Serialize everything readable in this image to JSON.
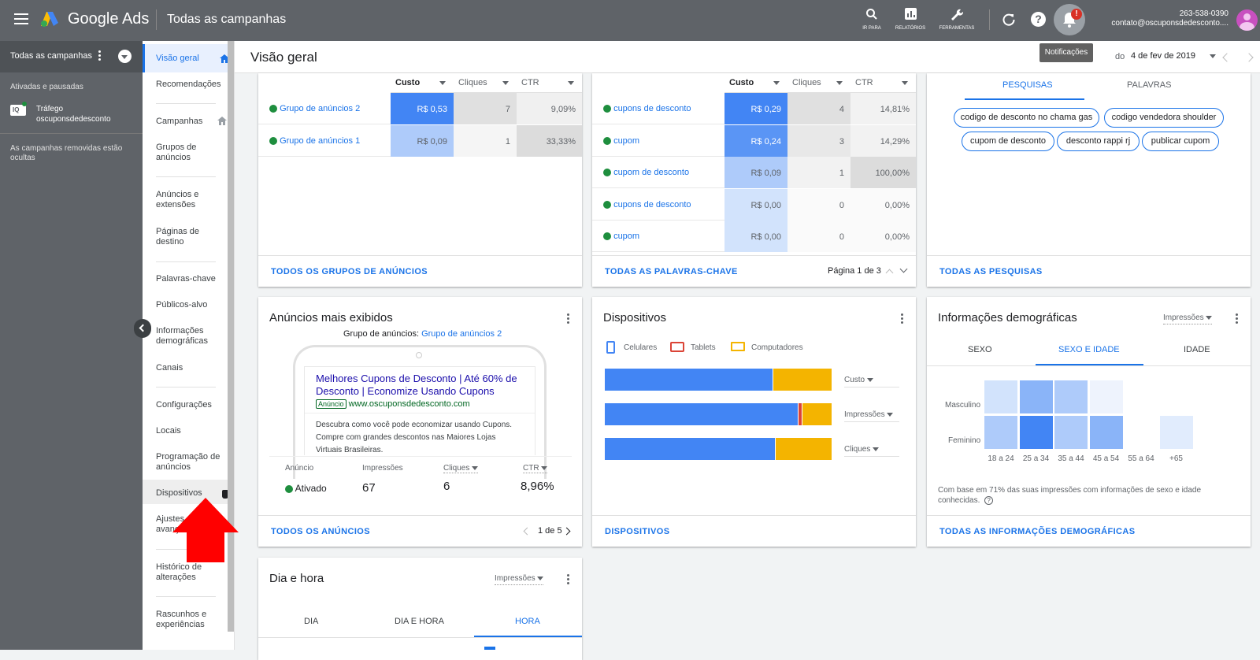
{
  "topbar": {
    "app_name": "Google Ads",
    "page_title": "Todas as campanhas",
    "tools": [
      {
        "label": "IR PARA",
        "icon": "search-icon"
      },
      {
        "label": "RELATÓRIOS",
        "icon": "reports-icon"
      },
      {
        "label": "FERRAMENTAS",
        "icon": "wrench-icon"
      }
    ],
    "customer_id": "263-538-0390",
    "account_email": "contato@oscuponsdedesconto....",
    "notification_tooltip": "Notificações",
    "notification_badge": "!"
  },
  "left_panel": {
    "campaign_selector": "Todas as campanhas",
    "section_label": "Ativadas e pausadas",
    "campaign_name": "Tráfego oscuponsdedesconto",
    "removed_note": "As campanhas removidas estão ocultas"
  },
  "nav": {
    "items": [
      "Visão geral",
      "Recomendações",
      "Campanhas",
      "Grupos de anúncios",
      "Anúncios e extensões",
      "Páginas de destino",
      "Palavras-chave",
      "Públicos-alvo",
      "Informações demográficas",
      "Canais",
      "Configurações",
      "Locais",
      "Programação de anúncios",
      "Dispositivos",
      "Ajustes avançados",
      "Histórico de alterações",
      "Rascunhos e experiências"
    ]
  },
  "header": {
    "title": "Visão geral",
    "date_prefix": "do",
    "date_range": "4 de fev de 2019"
  },
  "ad_groups_card": {
    "columns": [
      "Custo",
      "Cliques",
      "CTR"
    ],
    "rows": [
      {
        "name": "Grupo de anúncios 2",
        "cost": "R$ 0,53",
        "clicks": "7",
        "ctr": "9,09%"
      },
      {
        "name": "Grupo de anúncios 1",
        "cost": "R$ 0,09",
        "clicks": "1",
        "ctr": "33,33%"
      }
    ],
    "footer_link": "TODOS OS GRUPOS DE ANÚNCIOS"
  },
  "keywords_card": {
    "columns": [
      "Custo",
      "Cliques",
      "CTR"
    ],
    "rows": [
      {
        "name": "cupons de desconto",
        "cost": "R$ 0,29",
        "clicks": "4",
        "ctr": "14,81%"
      },
      {
        "name": "cupom",
        "cost": "R$ 0,24",
        "clicks": "3",
        "ctr": "14,29%"
      },
      {
        "name": "cupom de desconto",
        "cost": "R$ 0,09",
        "clicks": "1",
        "ctr": "100,00%"
      },
      {
        "name": "cupons de desconto",
        "cost": "R$ 0,00",
        "clicks": "0",
        "ctr": "0,00%"
      },
      {
        "name": "cupom",
        "cost": "R$ 0,00",
        "clicks": "0",
        "ctr": "0,00%"
      }
    ],
    "footer_link": "TODAS AS PALAVRAS-CHAVE",
    "pagination": "Página 1 de 3"
  },
  "searches_card": {
    "tabs": [
      "PESQUISAS",
      "PALAVRAS"
    ],
    "chips": [
      "codigo de desconto no chama gas",
      "codigo vendedora shoulder",
      "cupom de desconto",
      "desconto rappi rj",
      "publicar cupom"
    ],
    "footer_link": "TODAS AS PESQUISAS"
  },
  "ads_card": {
    "title": "Anúncios mais exibidos",
    "group_label": "Grupo de anúncios:",
    "group_name": "Grupo de anúncios 2",
    "ad_headline": "Melhores Cupons de Desconto | Até 60% de Desconto | Economize Usando Cupons",
    "ad_badge": "Anúncio",
    "ad_url": "www.oscuponsdedesconto.com",
    "ad_description": "Descubra como você pode economizar usando Cupons. Compre com grandes descontos nas Maiores Lojas Virtuais Brasileiras.",
    "stats_labels": [
      "Anúncio",
      "Impressões",
      "Cliques",
      "CTR"
    ],
    "stats_values": [
      "Ativado",
      "67",
      "6",
      "8,96%"
    ],
    "footer_link": "TODOS OS ANÚNCIOS",
    "pagination": "1 de 5"
  },
  "devices_card": {
    "title": "Dispositivos",
    "legend": [
      "Celulares",
      "Tablets",
      "Computadores"
    ],
    "colors": {
      "mobile": "#4285f4",
      "tablet": "#db4437",
      "desktop": "#f4b400"
    },
    "metrics": [
      {
        "label": "Custo",
        "mobile": 0.74,
        "tablet": 0.0,
        "desktop": 0.26
      },
      {
        "label": "Impressões",
        "mobile": 0.85,
        "tablet": 0.02,
        "desktop": 0.13
      },
      {
        "label": "Cliques",
        "mobile": 0.75,
        "tablet": 0.0,
        "desktop": 0.25
      }
    ],
    "footer_link": "DISPOSITIVOS"
  },
  "demographics_card": {
    "title": "Informações demográficas",
    "metric_select": "Impressões",
    "tabs": [
      "SEXO",
      "SEXO E IDADE",
      "IDADE"
    ],
    "rows": [
      "Masculino",
      "Feminino"
    ],
    "age_groups": [
      "18 a 24",
      "25 a 34",
      "35 a 44",
      "45 a 54",
      "55 a 64",
      "+65"
    ],
    "heat_colors": [
      [
        "#d2e3fc",
        "#8ab4f8",
        "#aecbfa",
        "#eef3fd",
        null,
        null
      ],
      [
        "#aecbfa",
        "#4285f4",
        "#aecbfa",
        "#8ab4f8",
        null,
        "#e1ecfd"
      ]
    ],
    "note": "Com base em 71% das suas impressões com informações de sexo e idade conhecidas.",
    "footer_link": "TODAS AS INFORMAÇÕES DEMOGRÁFICAS"
  },
  "dayhour_card": {
    "title": "Dia e hora",
    "metric_select": "Impressões",
    "tabs": [
      "DIA",
      "DIA E HORA",
      "HORA"
    ]
  }
}
